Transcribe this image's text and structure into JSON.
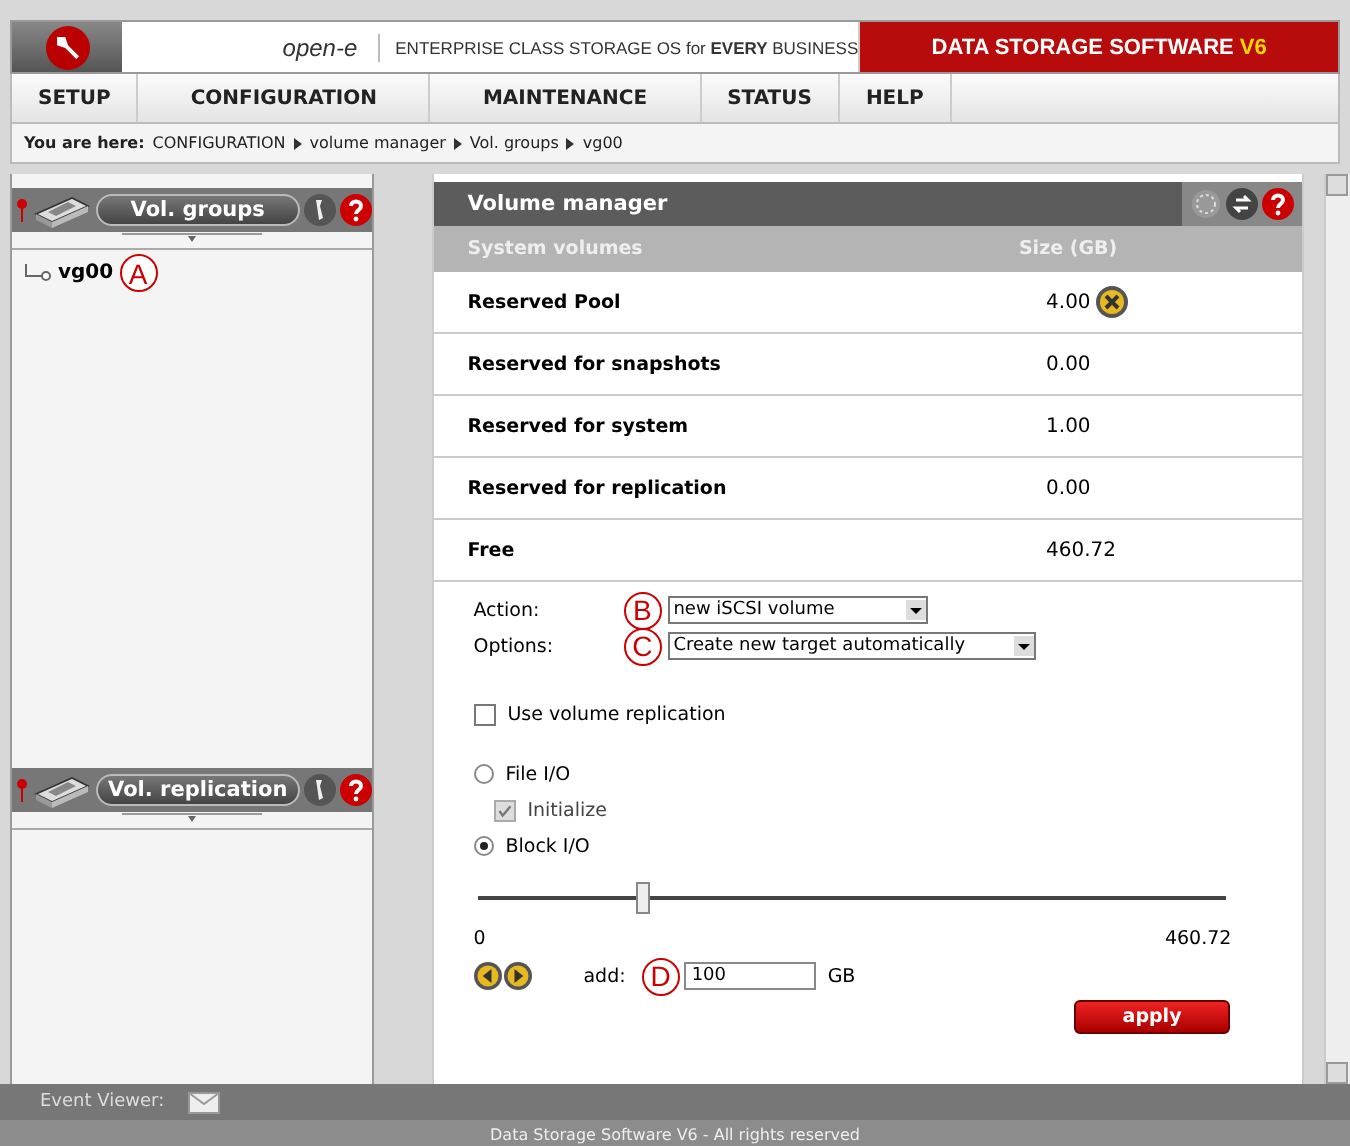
{
  "header": {
    "logo": "open-e",
    "tagline": "ENTERPRISE CLASS STORAGE OS for **EVERY** BUSINESS",
    "product": "DATA STORAGE SOFTWARE",
    "version": "V6"
  },
  "menu": [
    "SETUP",
    "CONFIGURATION",
    "MAINTENANCE",
    "STATUS",
    "HELP"
  ],
  "breadcrumb": {
    "label": "You are here:",
    "path": [
      "CONFIGURATION",
      "volume manager",
      "Vol. groups",
      "vg00"
    ]
  },
  "sidebar": [
    {
      "title": "Vol. groups",
      "items": [
        {
          "label": "vg00",
          "callout": "A"
        }
      ]
    },
    {
      "title": "Vol. replication"
    }
  ],
  "panel": {
    "title": "Volume manager",
    "columns": [
      "System volumes",
      "Size (GB)"
    ],
    "rows": [
      {
        "name": "Reserved Pool",
        "size": "4.00",
        "removable": true
      },
      {
        "name": "Reserved for snapshots",
        "size": "0.00",
        "removable": false
      },
      {
        "name": "Reserved for system",
        "size": "1.00",
        "removable": false
      },
      {
        "name": "Reserved for replication",
        "size": "0.00",
        "removable": false
      },
      {
        "name": "Free",
        "size": "460.72",
        "removable": false
      }
    ],
    "form": {
      "fields": [
        {
          "label": "Action:",
          "value": "new iSCSI volume",
          "callout": "B"
        },
        {
          "label": "Options:",
          "value": "Create new target automatically",
          "callout": "C"
        }
      ],
      "replication": {
        "label": "Use volume replication",
        "checked": false
      },
      "io": [
        {
          "label": "File I/O",
          "selected": false,
          "option": {
            "label": "Initialize",
            "checked": true,
            "disabled": true
          }
        },
        {
          "label": "Block I/O",
          "selected": true
        }
      ],
      "slider": {
        "level": 0.22,
        "min": "0",
        "max": "460.72"
      },
      "add": {
        "label": "add:",
        "value": "100",
        "unit": "GB",
        "callout": "D"
      },
      "apply": "apply"
    }
  },
  "event_viewer": "Event Viewer:",
  "footer": "Data Storage Software V6 - All rights reserved"
}
